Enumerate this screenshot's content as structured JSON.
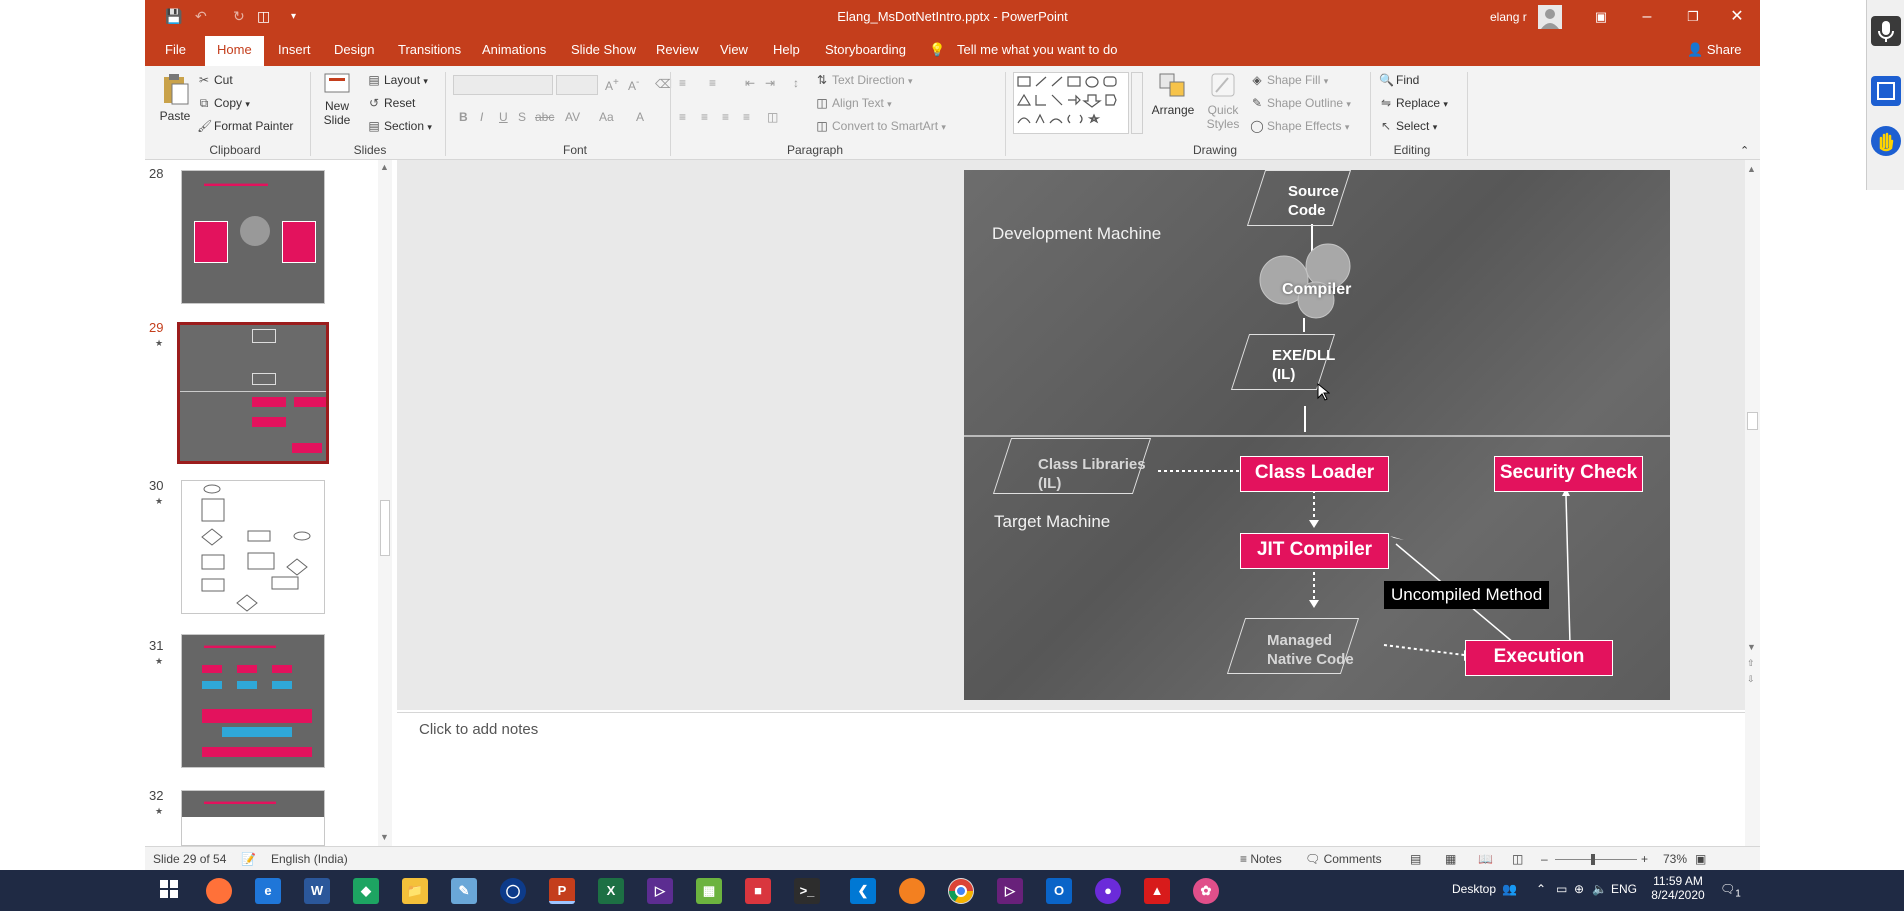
{
  "window": {
    "title": "Elang_MsDotNetIntro.pptx  -  PowerPoint",
    "user": "elang r"
  },
  "tabs": [
    "File",
    "Home",
    "Insert",
    "Design",
    "Transitions",
    "Animations",
    "Slide Show",
    "Review",
    "View",
    "Help",
    "Storyboarding"
  ],
  "active_tab": "Home",
  "tell_me": "Tell me what you want to do",
  "share": "Share",
  "ribbon": {
    "clipboard": {
      "label": "Clipboard",
      "paste": "Paste",
      "cut": "Cut",
      "copy": "Copy",
      "format_painter": "Format Painter"
    },
    "slides": {
      "label": "Slides",
      "new_slide": "New",
      "new_slide2": "Slide",
      "layout": "Layout",
      "reset": "Reset",
      "section": "Section"
    },
    "font": {
      "label": "Font"
    },
    "paragraph": {
      "label": "Paragraph",
      "text_direction": "Text Direction",
      "align_text": "Align Text",
      "convert_smartart": "Convert to SmartArt"
    },
    "drawing": {
      "label": "Drawing",
      "arrange": "Arrange",
      "quick_styles": "Quick",
      "quick_styles2": "Styles",
      "shape_fill": "Shape Fill",
      "shape_outline": "Shape Outline",
      "shape_effects": "Shape Effects"
    },
    "editing": {
      "label": "Editing",
      "find": "Find",
      "replace": "Replace",
      "select": "Select"
    }
  },
  "thumbnails": [
    {
      "num": "28",
      "star": "",
      "selected": false
    },
    {
      "num": "29",
      "star": "★",
      "selected": true
    },
    {
      "num": "30",
      "star": "★",
      "selected": false
    },
    {
      "num": "31",
      "star": "★",
      "selected": false
    },
    {
      "num": "32",
      "star": "★",
      "selected": false
    }
  ],
  "slide": {
    "dev_machine": "Development Machine",
    "target_machine": "Target Machine",
    "source_code_1": "Source",
    "source_code_2": "Code",
    "compiler": "Compiler",
    "exe_1": "EXE/DLL",
    "exe_2": "(IL)",
    "class_libs_1": "Class Libraries",
    "class_libs_2": "(IL)",
    "class_loader": "Class Loader",
    "security_check": "Security Check",
    "jit_compiler": "JIT Compiler",
    "uncompiled_method": "Uncompiled Method",
    "managed_1": "Managed",
    "managed_2": "Native Code",
    "execution": "Execution"
  },
  "notes_placeholder": "Click to add notes",
  "status": {
    "slide_info": "Slide 29 of 54",
    "language": "English (India)",
    "notes": "Notes",
    "comments": "Comments",
    "zoom": "73%"
  },
  "taskbar": {
    "desktop": "Desktop",
    "lang": "ENG",
    "time": "11:59 AM",
    "date": "8/24/2020",
    "notif_count": "1"
  },
  "colors": {
    "accent": "#c43e1c",
    "pink": "#e3125d",
    "selection": "#9b1c1c"
  }
}
